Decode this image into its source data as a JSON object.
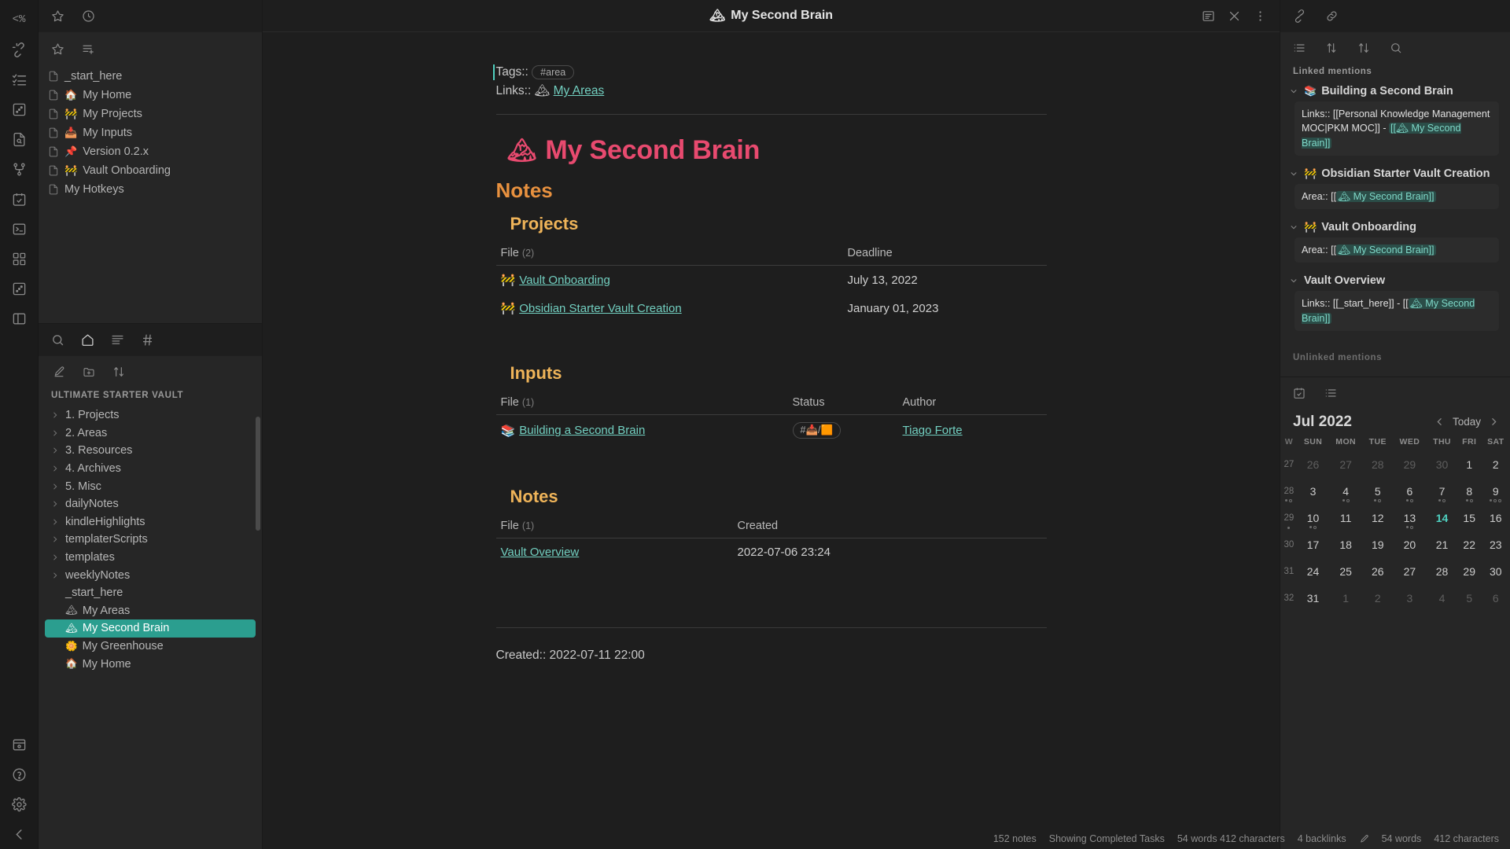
{
  "ribbon": {
    "items": [
      {
        "name": "templater-icon",
        "glyph": "<%"
      },
      {
        "name": "unlink-icon"
      },
      {
        "name": "checklist-icon"
      },
      {
        "name": "random-note-icon"
      },
      {
        "name": "file-search-icon"
      },
      {
        "name": "graph-view-icon"
      },
      {
        "name": "calendar-check-icon"
      },
      {
        "name": "terminal-icon"
      },
      {
        "name": "grid-apps-icon"
      },
      {
        "name": "dice-icon"
      },
      {
        "name": "layout-sidebar-icon"
      }
    ],
    "bottom_items": [
      {
        "name": "vault-switcher-icon"
      },
      {
        "name": "help-icon"
      },
      {
        "name": "settings-gear-icon"
      },
      {
        "name": "collapse-left-icon"
      }
    ]
  },
  "left_sidebar": {
    "tabbar": [
      {
        "name": "bookmarks-tab",
        "icon": "star-icon"
      },
      {
        "name": "recent-files-tab",
        "icon": "clock-icon"
      }
    ],
    "bookmarks_header": [
      {
        "name": "bookmark-current-button",
        "icon": "star-icon"
      },
      {
        "name": "new-bookmark-group-button",
        "icon": "list-plus-icon"
      }
    ],
    "bookmarks": [
      {
        "label": "_start_here",
        "emoji": ""
      },
      {
        "label": "My Home",
        "emoji": "🏠"
      },
      {
        "label": "My Projects",
        "emoji": "🚧"
      },
      {
        "label": "My Inputs",
        "emoji": "📥"
      },
      {
        "label": "Version 0.2.x",
        "emoji": "📌"
      },
      {
        "label": "Vault Onboarding",
        "emoji": "🚧"
      },
      {
        "label": "My Hotkeys",
        "emoji": ""
      }
    ],
    "explorer_tabs": [
      {
        "name": "search-tab",
        "icon": "search-icon"
      },
      {
        "name": "home-tab",
        "icon": "home-icon"
      },
      {
        "name": "file-explorer-tab",
        "icon": "files-icon"
      },
      {
        "name": "tags-tab",
        "icon": "hash-icon"
      }
    ],
    "explorer_actions": [
      {
        "name": "new-note-button",
        "icon": "new-note-icon"
      },
      {
        "name": "new-folder-button",
        "icon": "new-folder-icon"
      },
      {
        "name": "change-sort-order-button",
        "icon": "sort-icon"
      }
    ],
    "vault_name": "Ultimate Starter Vault",
    "tree": [
      {
        "label": "1. Projects",
        "type": "folder"
      },
      {
        "label": "2. Areas",
        "type": "folder"
      },
      {
        "label": "3. Resources",
        "type": "folder"
      },
      {
        "label": "4. Archives",
        "type": "folder"
      },
      {
        "label": "5. Misc",
        "type": "folder"
      },
      {
        "label": "dailyNotes",
        "type": "folder"
      },
      {
        "label": "kindleHighlights",
        "type": "folder"
      },
      {
        "label": "templaterScripts",
        "type": "folder"
      },
      {
        "label": "templates",
        "type": "folder"
      },
      {
        "label": "weeklyNotes",
        "type": "folder"
      },
      {
        "label": "_start_here",
        "type": "file",
        "emoji": ""
      },
      {
        "label": "My Areas",
        "type": "file",
        "emoji": "🏔"
      },
      {
        "label": "My Second Brain",
        "type": "file",
        "emoji": "🏔",
        "selected": true
      },
      {
        "label": "My Greenhouse",
        "type": "file",
        "emoji": "🌼"
      },
      {
        "label": "My Home",
        "type": "file",
        "emoji": "🏠"
      }
    ]
  },
  "center": {
    "title": "My Second Brain",
    "title_emoji": "🏔",
    "header_actions": [
      {
        "name": "reading-view-button",
        "icon": "reading-view-icon"
      },
      {
        "name": "close-tab-button",
        "icon": "close-icon"
      },
      {
        "name": "more-options-button",
        "icon": "more-vertical-icon"
      }
    ],
    "frontmatter": {
      "tags_label": "Tags::",
      "tag_value": "#area",
      "links_label": "Links::",
      "links_emoji": "🏔",
      "links_value": "My Areas"
    },
    "h1": "My Second Brain",
    "h1_emoji": "🏔",
    "h2_notes": "Notes",
    "projects": {
      "heading": "Projects",
      "columns": [
        "File",
        "Deadline"
      ],
      "count": "(2)",
      "rows": [
        {
          "emoji": "🚧",
          "file": "Vault Onboarding",
          "deadline": "July 13, 2022"
        },
        {
          "emoji": "🚧",
          "file": "Obsidian Starter Vault Creation",
          "deadline": "January 01, 2023"
        }
      ]
    },
    "inputs": {
      "heading": "Inputs",
      "columns": [
        "File",
        "Status",
        "Author"
      ],
      "count": "(1)",
      "rows": [
        {
          "emoji": "📚",
          "file": "Building a Second Brain",
          "status": "#📥/🟧",
          "author": "Tiago Forte"
        }
      ]
    },
    "notes": {
      "heading": "Notes",
      "columns": [
        "File",
        "Created"
      ],
      "count": "(1)",
      "rows": [
        {
          "emoji": "",
          "file": "Vault Overview",
          "created": "2022-07-06 23:24"
        }
      ]
    },
    "created_line": "Created:: 2022-07-11 22:00"
  },
  "right_sidebar": {
    "tabbar": [
      {
        "name": "backlinks-tab",
        "icon": "link-broken-icon"
      },
      {
        "name": "outgoing-links-tab",
        "icon": "links-icon"
      }
    ],
    "backlinks_toolbar": [
      {
        "name": "collapse-results-button",
        "icon": "list-icon"
      },
      {
        "name": "show-more-context-button",
        "icon": "arrow-up-down-icon"
      },
      {
        "name": "change-sort-order-button",
        "icon": "sort-icon"
      },
      {
        "name": "search-backlinks-button",
        "icon": "search-icon"
      }
    ],
    "linked_mentions_label": "Linked mentions",
    "unlinked_mentions_label": "Unlinked mentions",
    "groups": [
      {
        "title": "Building a Second Brain",
        "emoji": "📚",
        "context_prefix": "Links:: [[Personal Knowledge Management MOC|PKM MOC]] - ",
        "context_link": "[[🏔 My Second Brain]]"
      },
      {
        "title": "Obsidian Starter Vault Creation",
        "emoji": "🚧",
        "context_prefix": "Area:: [[",
        "context_link": "🏔 My Second Brain]]"
      },
      {
        "title": "Vault Onboarding",
        "emoji": "🚧",
        "context_prefix": "Area:: [[",
        "context_link": "🏔 My Second Brain]]"
      },
      {
        "title": "Vault Overview",
        "emoji": "",
        "context_prefix": "Links:: [[_start_here]] - [[",
        "context_link": "🏔 My Second Brain]]"
      }
    ],
    "calendar_toolbar": [
      {
        "name": "calendar-tab",
        "icon": "calendar-check-icon"
      },
      {
        "name": "outline-tab",
        "icon": "list-icon"
      }
    ],
    "calendar": {
      "month": "Jul 2022",
      "today_label": "Today",
      "prev_name": "previous-month-button",
      "next_name": "next-month-button",
      "weekday_headers": [
        "W",
        "SUN",
        "MON",
        "TUE",
        "WED",
        "THU",
        "FRI",
        "SAT"
      ],
      "weeks": [
        {
          "w": "27",
          "days": [
            {
              "d": "26",
              "adj": true
            },
            {
              "d": "27",
              "adj": true
            },
            {
              "d": "28",
              "adj": true
            },
            {
              "d": "29",
              "adj": true
            },
            {
              "d": "30",
              "adj": true
            },
            {
              "d": "1"
            },
            {
              "d": "2"
            }
          ]
        },
        {
          "w": "28",
          "wdots": 2,
          "days": [
            {
              "d": "3"
            },
            {
              "d": "4",
              "dots": 2
            },
            {
              "d": "5",
              "dots": 2
            },
            {
              "d": "6",
              "dots": 2
            },
            {
              "d": "7",
              "dots": 2
            },
            {
              "d": "8",
              "dots": 2
            },
            {
              "d": "9",
              "dots": 3
            }
          ]
        },
        {
          "w": "29",
          "wdots": 1,
          "days": [
            {
              "d": "10",
              "dots": 2
            },
            {
              "d": "11"
            },
            {
              "d": "12"
            },
            {
              "d": "13",
              "dots": 2
            },
            {
              "d": "14",
              "today": true
            },
            {
              "d": "15"
            },
            {
              "d": "16"
            }
          ]
        },
        {
          "w": "30",
          "days": [
            {
              "d": "17"
            },
            {
              "d": "18"
            },
            {
              "d": "19"
            },
            {
              "d": "20"
            },
            {
              "d": "21"
            },
            {
              "d": "22"
            },
            {
              "d": "23"
            }
          ]
        },
        {
          "w": "31",
          "days": [
            {
              "d": "24"
            },
            {
              "d": "25"
            },
            {
              "d": "26"
            },
            {
              "d": "27"
            },
            {
              "d": "28"
            },
            {
              "d": "29"
            },
            {
              "d": "30"
            }
          ]
        },
        {
          "w": "32",
          "days": [
            {
              "d": "31"
            },
            {
              "d": "1",
              "adj": true
            },
            {
              "d": "2",
              "adj": true
            },
            {
              "d": "3",
              "adj": true
            },
            {
              "d": "4",
              "adj": true
            },
            {
              "d": "5",
              "adj": true
            },
            {
              "d": "6",
              "adj": true
            }
          ]
        }
      ]
    }
  },
  "statusbar": {
    "notes_count": "152 notes",
    "tasks": "Showing Completed Tasks",
    "words_chars": "54 words 412 characters",
    "backlinks": "4 backlinks",
    "words": "54 words",
    "characters": "412 characters"
  }
}
